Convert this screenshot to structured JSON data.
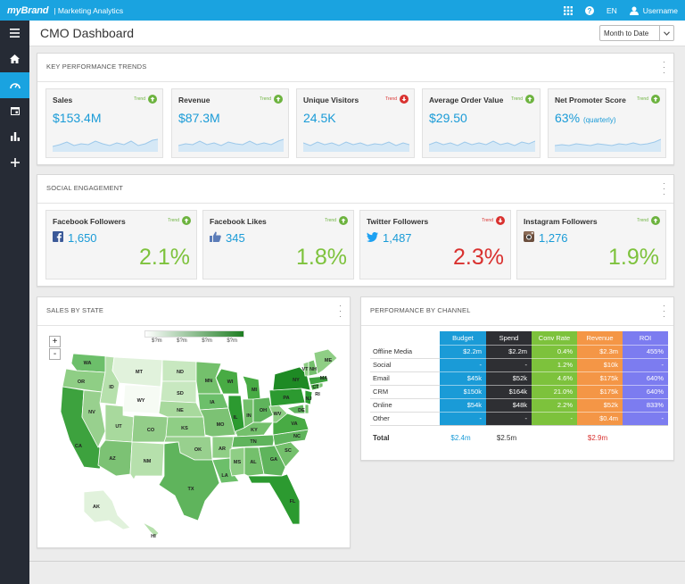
{
  "topbar": {
    "brand": "myBrand",
    "app_title": "| Marketing Analytics",
    "language": "EN",
    "username": "Username",
    "icons": [
      "grid-icon",
      "help-icon",
      "user-icon"
    ]
  },
  "sidebar": {
    "items": [
      {
        "name": "menu",
        "icon": "hamburger-icon"
      },
      {
        "name": "home",
        "icon": "home-icon"
      },
      {
        "name": "dashboard",
        "icon": "gauge-icon",
        "active": true
      },
      {
        "name": "calendar",
        "icon": "calendar-icon"
      },
      {
        "name": "reports",
        "icon": "bar-chart-icon"
      },
      {
        "name": "add",
        "icon": "plus-icon"
      }
    ]
  },
  "header": {
    "title": "CMO Dashboard",
    "range": "Month to Date"
  },
  "kpi": {
    "title": "KEY PERFORMANCE TRENDS",
    "cards": [
      {
        "label": "Sales",
        "value": "$153.4M",
        "trend_word": "Trend",
        "trend": "up"
      },
      {
        "label": "Revenue",
        "value": "$87.3M",
        "trend_word": "Trend",
        "trend": "up"
      },
      {
        "label": "Unique Visitors",
        "value": "24.5K",
        "trend_word": "Trend",
        "trend": "down"
      },
      {
        "label": "Average Order Value",
        "value": "$29.50",
        "trend_word": "Trend",
        "trend": "up"
      },
      {
        "label": "Net Promoter Score",
        "value": "63%",
        "sub": "(quarterly)",
        "trend_word": "Trend",
        "trend": "up"
      }
    ]
  },
  "social": {
    "title": "SOCIAL ENGAGEMENT",
    "cards": [
      {
        "label": "Facebook Followers",
        "value": "1,650",
        "pct": "2.1%",
        "trend_word": "Trend",
        "trend": "up",
        "icon": "facebook-icon"
      },
      {
        "label": "Facebook Likes",
        "value": "345",
        "pct": "1.8%",
        "trend_word": "Trend",
        "trend": "up",
        "icon": "thumbs-up-icon"
      },
      {
        "label": "Twitter Followers",
        "value": "1,487",
        "pct": "2.3%",
        "trend_word": "Trend",
        "trend": "down",
        "icon": "twitter-icon"
      },
      {
        "label": "Instagram Followers",
        "value": "1,276",
        "pct": "1.9%",
        "trend_word": "Trend",
        "trend": "up",
        "icon": "instagram-icon"
      }
    ]
  },
  "map": {
    "title": "SALES BY STATE",
    "zoom_in": "+",
    "zoom_out": "-",
    "legend": [
      "$?m",
      "$?m",
      "$?m",
      "$?m"
    ]
  },
  "channel": {
    "title": "PERFORMANCE BY CHANNEL",
    "columns": [
      "Budget",
      "Spend",
      "Conv Rate",
      "Revenue",
      "ROI"
    ],
    "rows": [
      {
        "label": "Offline Media",
        "cells": [
          "$2.2m",
          "$2.2m",
          "0.4%",
          "$2.3m",
          "455%"
        ]
      },
      {
        "label": "Social",
        "cells": [
          "-",
          "-",
          "1.2%",
          "$10k",
          "-"
        ]
      },
      {
        "label": "Email",
        "cells": [
          "$45k",
          "$52k",
          "4.6%",
          "$175k",
          "640%"
        ]
      },
      {
        "label": "CRM",
        "cells": [
          "$150k",
          "$164k",
          "21.0%",
          "$175k",
          "640%"
        ]
      },
      {
        "label": "Online",
        "cells": [
          "$54k",
          "$48k",
          "2.2%",
          "$52k",
          "833%"
        ]
      },
      {
        "label": "Other",
        "cells": [
          "-",
          "-",
          "-",
          "$0.4m",
          "-"
        ]
      }
    ],
    "total": {
      "label": "Total",
      "budget": "$2.4m",
      "spend": "$2.5m",
      "revenue": "$2.9m"
    }
  },
  "colors": {
    "accent": "#1aa3e0",
    "sidebar": "#262b35",
    "up": "#7dc23c",
    "down": "#d9312f",
    "budget": "#1a9bd7",
    "spend": "#2e2f33",
    "conv": "#7dc23c",
    "revenue": "#f49646",
    "roi": "#7c7cf0"
  }
}
